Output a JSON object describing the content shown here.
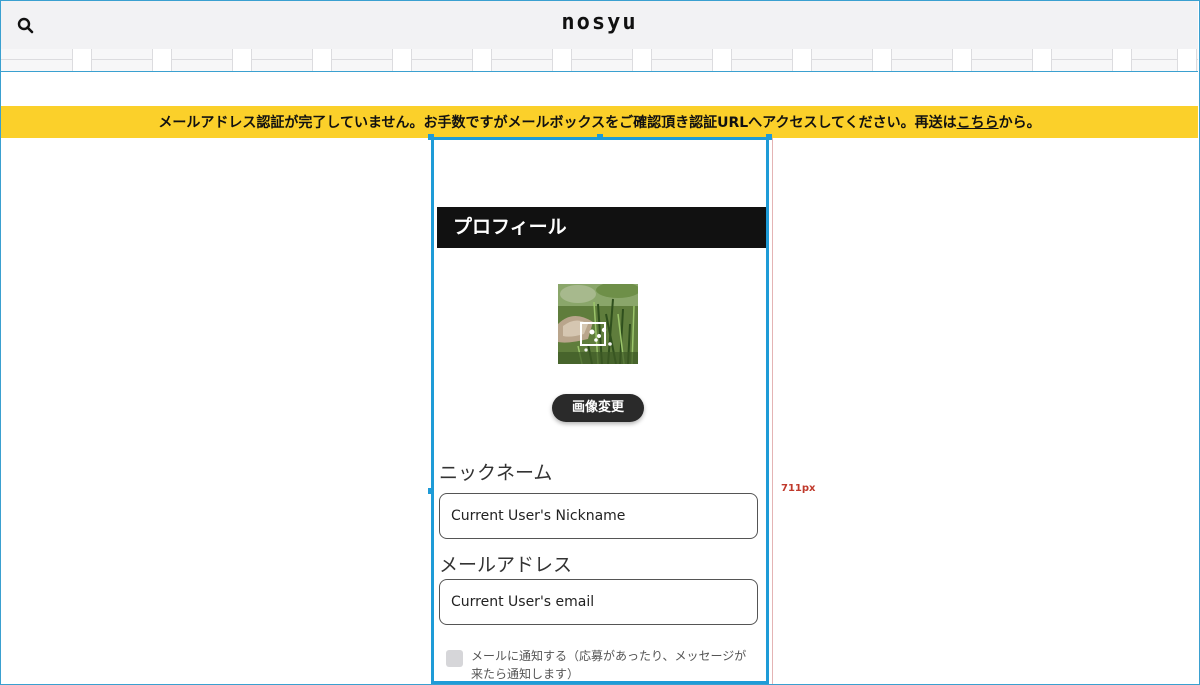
{
  "header": {
    "logo": "nosyu",
    "search_icon": "search-icon"
  },
  "banner": {
    "message": "メールアドレス認証が完了していません。お手数ですがメールボックスをご確認頂き認証URLへアクセスしてください。再送は",
    "link": "こちら",
    "suffix": "から。",
    "color": "#fbd02a"
  },
  "preview": {
    "height_label": "711px",
    "frame_color": "#1e9bd7"
  },
  "profile": {
    "title": "プロフィール",
    "avatar_icon": "avatar-photo",
    "change_image_label": "画像変更",
    "nickname_label": "ニックネーム",
    "nickname_value": "Current User's Nickname",
    "email_label": "メールアドレス",
    "email_value": "Current User's email",
    "notify_label": "メールに通知する（応募があったり、メッセージが来たら通知します）"
  }
}
